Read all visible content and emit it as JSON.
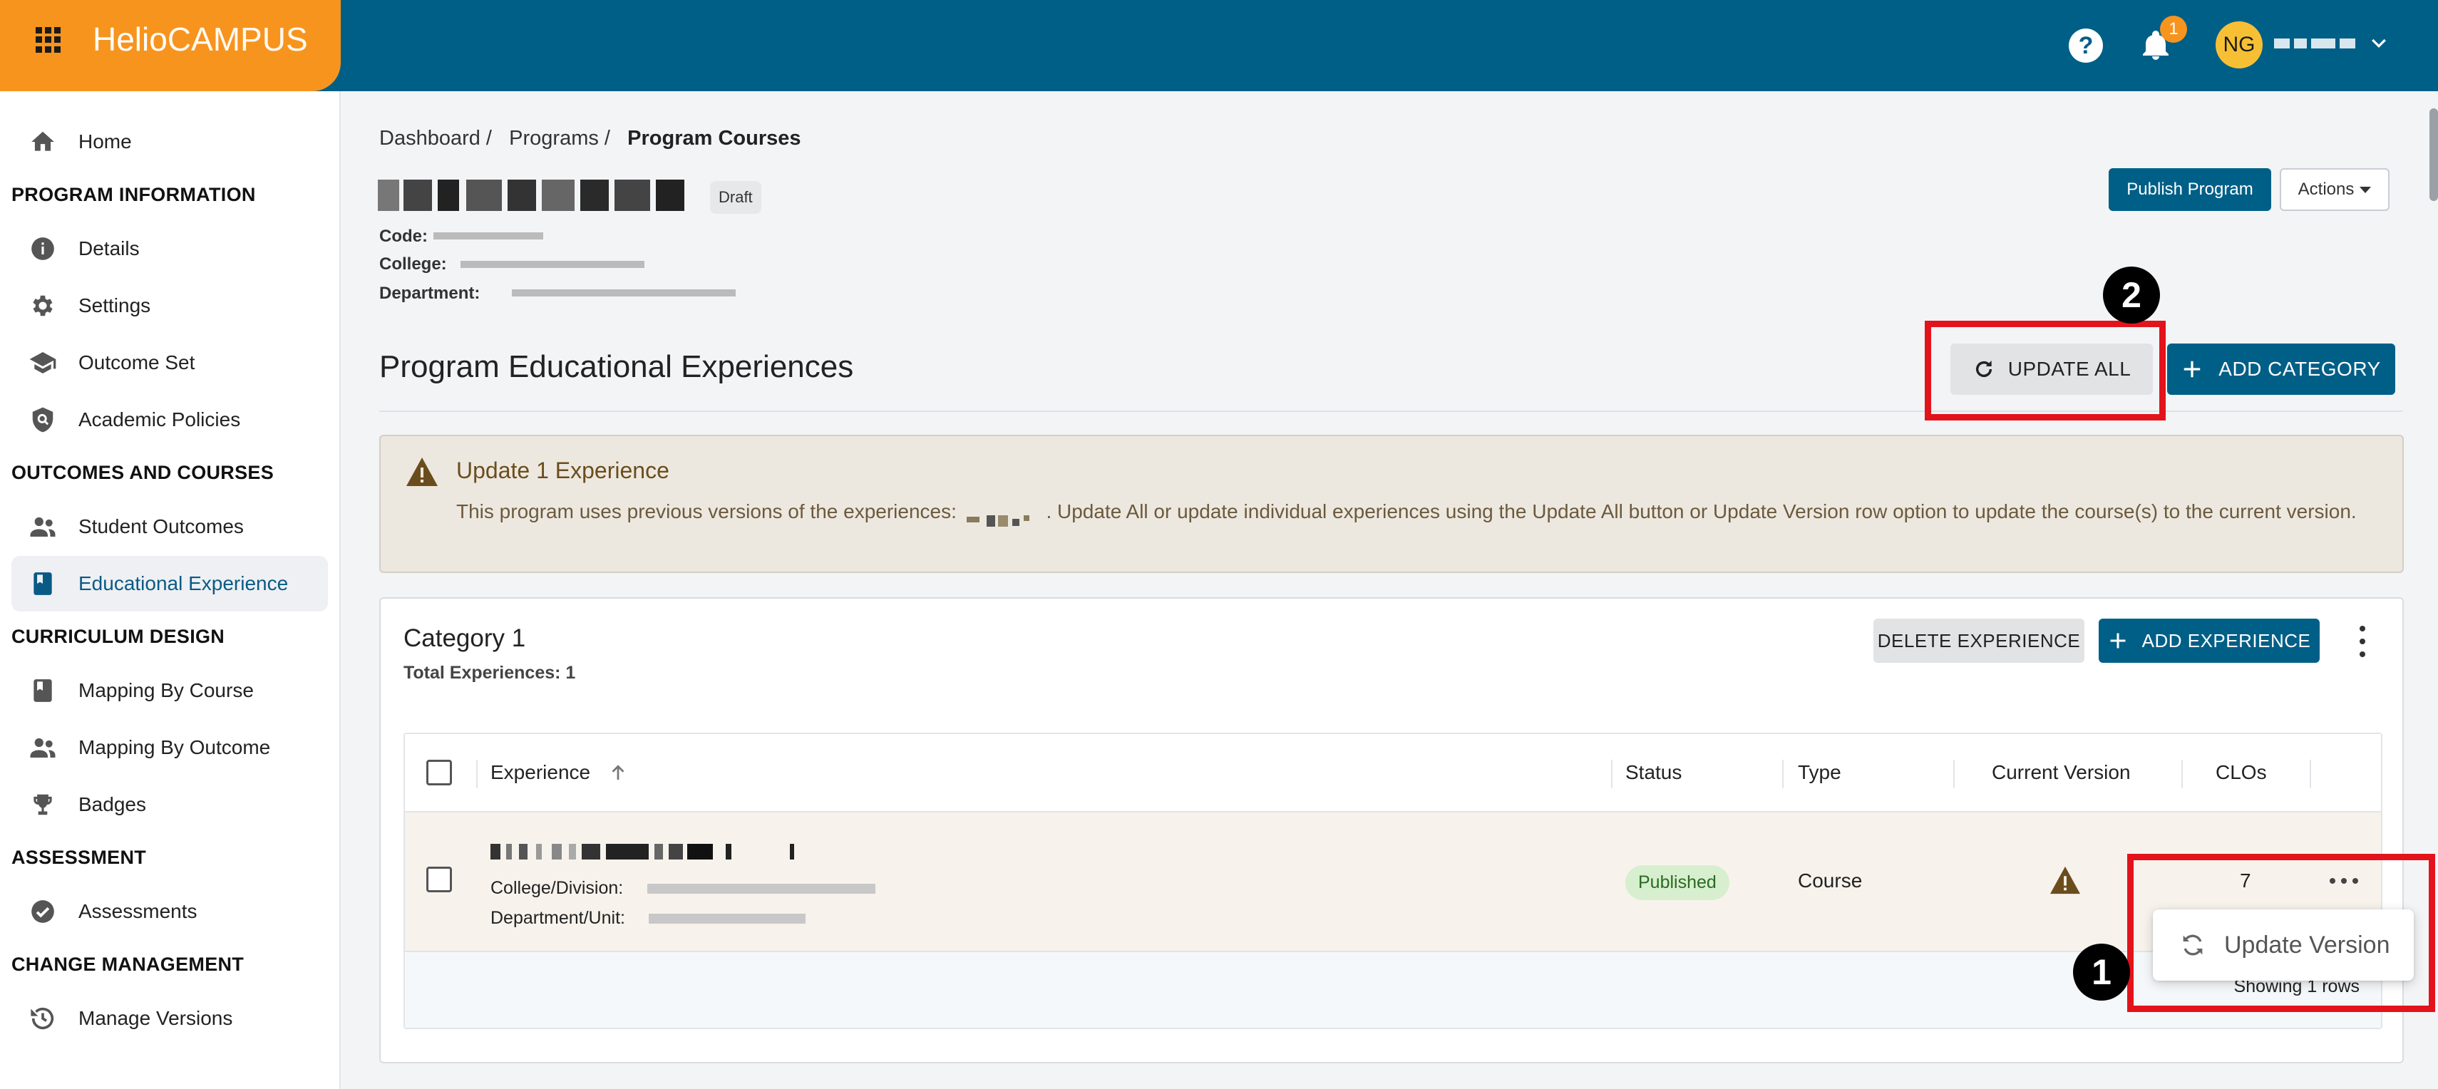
{
  "header": {
    "brand_part1": "Helio",
    "brand_part2": "CAMPUS",
    "notification_count": "1",
    "avatar_initials": "NG",
    "colors": {
      "topbar": "#005f87",
      "brand": "#f7941d"
    }
  },
  "sidebar": {
    "home": "Home",
    "section_program_info": "PROGRAM INFORMATION",
    "details": "Details",
    "settings": "Settings",
    "outcome_set": "Outcome Set",
    "academic_policies": "Academic Policies",
    "section_outcomes": "OUTCOMES AND COURSES",
    "student_outcomes": "Student Outcomes",
    "educational_experience": "Educational Experience",
    "section_curriculum": "CURRICULUM DESIGN",
    "mapping_by_course": "Mapping By Course",
    "mapping_by_outcome": "Mapping By Outcome",
    "badges": "Badges",
    "section_assessment": "ASSESSMENT",
    "assessments": "Assessments",
    "section_change": "CHANGE MANAGEMENT",
    "manage_versions": "Manage Versions"
  },
  "breadcrumb": {
    "item1": "Dashboard /",
    "item2": "Programs /",
    "current": "Program Courses"
  },
  "program": {
    "status_badge": "Draft",
    "code_label": "Code:",
    "college_label": "College:",
    "department_label": "Department:"
  },
  "toolbar": {
    "publish_label": "Publish Program",
    "actions_label": "Actions"
  },
  "section": {
    "title": "Program Educational Experiences",
    "update_all_label": "UPDATE ALL",
    "add_category_label": "ADD CATEGORY"
  },
  "alert": {
    "title": "Update 1 Experience",
    "body_before": "This program uses previous versions of the experiences:",
    "body_after": ". Update All or update individual experiences using the Update All button or Update Version row option to update the course(s) to the current version."
  },
  "category": {
    "title": "Category 1",
    "total": "Total Experiences: 1",
    "delete_label": "DELETE EXPERIENCE",
    "add_label": "ADD EXPERIENCE"
  },
  "table": {
    "columns": {
      "experience": "Experience",
      "status": "Status",
      "type": "Type",
      "current_version": "Current Version",
      "clos": "CLOs"
    },
    "rows": [
      {
        "college_label": "College/Division:",
        "department_label": "Department/Unit:",
        "status": "Published",
        "type": "Course",
        "clos": "7"
      }
    ],
    "footer": "Showing 1 rows"
  },
  "row_menu": {
    "update_version": "Update Version"
  },
  "callouts": {
    "first": "1",
    "second": "2"
  }
}
